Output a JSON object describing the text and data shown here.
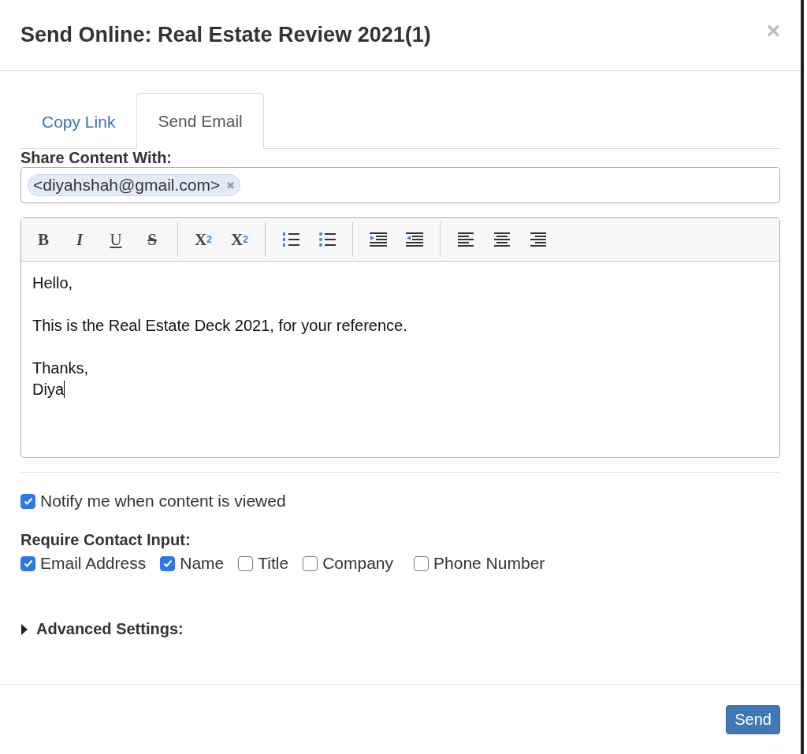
{
  "dialog": {
    "title": "Send Online: Real Estate Review 2021(1)",
    "close": "×"
  },
  "tabs": [
    {
      "label": "Copy Link",
      "selected": false
    },
    {
      "label": "Send Email",
      "selected": true
    }
  ],
  "share": {
    "label": "Share Content With:",
    "recipients": [
      "<diyahshah@gmail.com>"
    ],
    "remove": "✖"
  },
  "toolbar": [
    [
      {
        "kind": "bold",
        "label": "B"
      },
      {
        "kind": "italic",
        "label": "I"
      },
      {
        "kind": "underline",
        "label": "U"
      },
      {
        "kind": "strike",
        "label": "S"
      }
    ],
    [
      {
        "kind": "subscript",
        "label": "X",
        "script": "2"
      },
      {
        "kind": "superscript",
        "label": "X",
        "script": "2"
      }
    ],
    [
      {
        "kind": "ordered-list"
      },
      {
        "kind": "bullet-list"
      }
    ],
    [
      {
        "kind": "indent"
      },
      {
        "kind": "outdent"
      }
    ],
    [
      {
        "kind": "align-left"
      },
      {
        "kind": "align-center"
      },
      {
        "kind": "align-right"
      }
    ]
  ],
  "message": [
    [
      "Hello,"
    ],
    [
      "This is the Real Estate Deck 2021, for your reference."
    ],
    [
      "Thanks,",
      "Diya"
    ]
  ],
  "notify": {
    "label": "Notify me when content is viewed",
    "checked": true
  },
  "contact_input": {
    "label": "Require Contact Input:",
    "options": [
      {
        "label": "Email Address",
        "checked": true
      },
      {
        "label": "Name",
        "checked": true
      },
      {
        "label": "Title",
        "checked": false
      },
      {
        "label": "Company",
        "checked": false
      },
      {
        "label": "Phone Number",
        "checked": false
      }
    ]
  },
  "advanced": {
    "label": "Advanced Settings:",
    "expanded": false
  },
  "buttons": [
    {
      "label": "Send"
    }
  ]
}
